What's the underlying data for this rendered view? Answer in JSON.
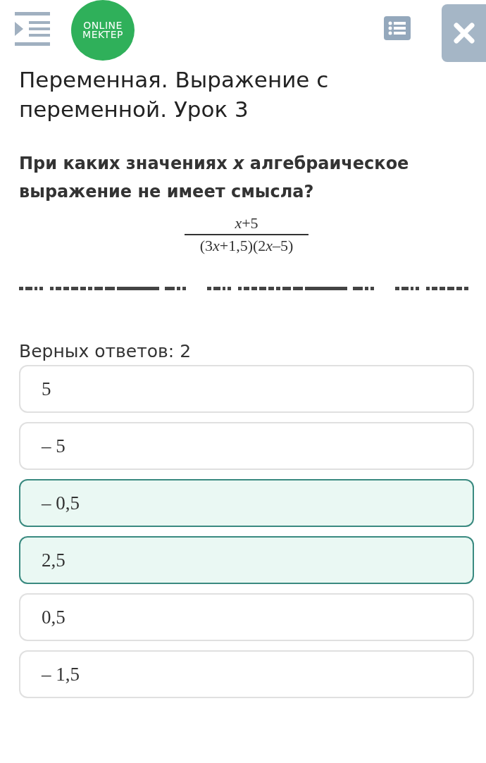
{
  "header": {
    "logo": [
      "ONLINE",
      "MEKTEP"
    ]
  },
  "lesson_title": "Переменная. Выражение с переменной. Урок 3",
  "question": "При каких значениях *x* алгебраическое выражение не имеет смысла?",
  "formula": {
    "numerator": "*x*+5",
    "denominator": [
      {
        "text": "(3",
        "italic": false
      },
      {
        "text": "x",
        "italic": true
      },
      {
        "text": "+1,5)(2",
        "italic": false
      },
      {
        "text": "x",
        "italic": true
      },
      {
        "text": "–5)",
        "italic": false
      }
    ]
  },
  "answers_count": "Верных ответов: 2",
  "options": [
    {
      "label": "5",
      "selected": false
    },
    {
      "label": "– 5",
      "selected": false
    },
    {
      "label": "– 0,5",
      "selected": true
    },
    {
      "label": "2,5",
      "selected": true
    },
    {
      "label": "0,5",
      "selected": false
    },
    {
      "label": "– 1,5",
      "selected": false
    }
  ]
}
